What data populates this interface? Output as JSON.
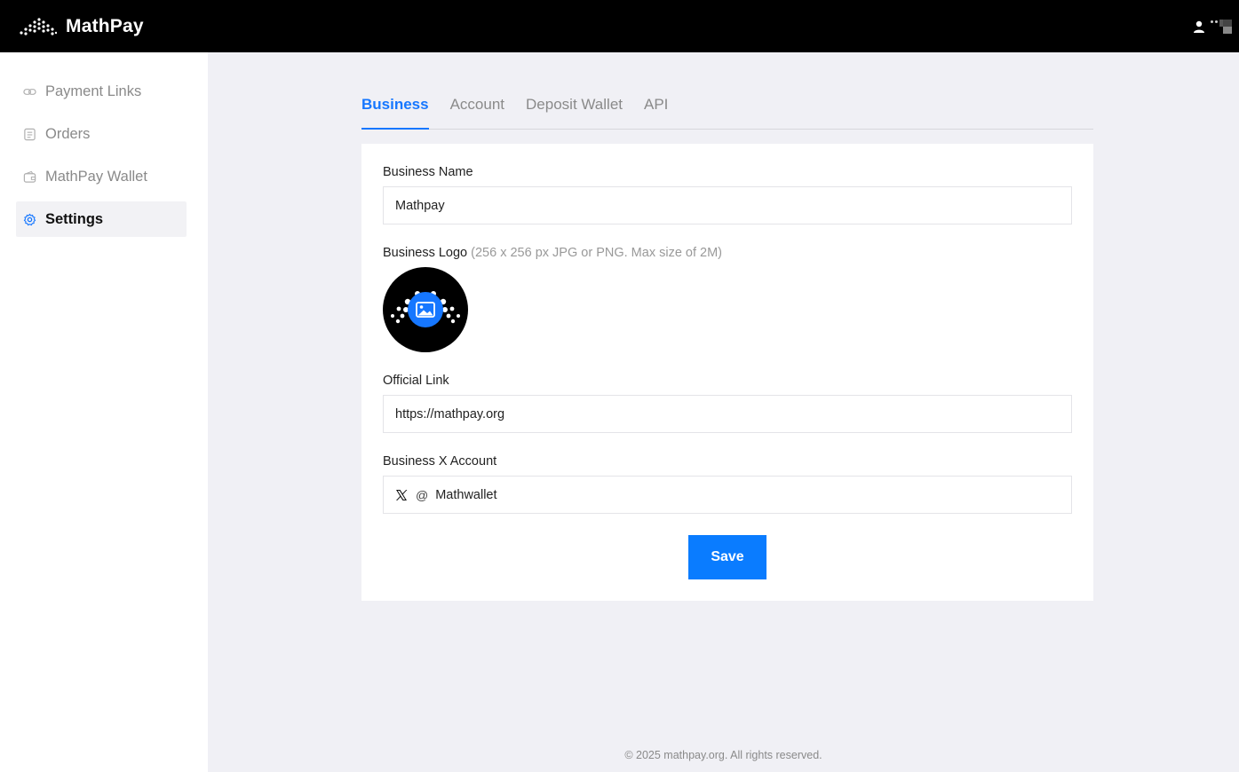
{
  "header": {
    "brand": "MathPay",
    "colors": {
      "background": "#000000",
      "brand_text": "#ffffff"
    },
    "icons": {
      "logo": "mathpay-dots-logo",
      "user": "user-icon",
      "avatar": "avatar-icon"
    }
  },
  "sidebar": {
    "items": [
      {
        "label": "Payment Links",
        "icon": "link-icon",
        "active": false
      },
      {
        "label": "Orders",
        "icon": "document-icon",
        "active": false
      },
      {
        "label": "MathPay Wallet",
        "icon": "wallet-icon",
        "active": false
      },
      {
        "label": "Settings",
        "icon": "gear-icon",
        "active": true
      }
    ]
  },
  "tabs": [
    {
      "label": "Business",
      "active": true
    },
    {
      "label": "Account",
      "active": false
    },
    {
      "label": "Deposit Wallet",
      "active": false
    },
    {
      "label": "API",
      "active": false
    }
  ],
  "form": {
    "business_name": {
      "label": "Business Name",
      "value": "Mathpay"
    },
    "business_logo": {
      "label": "Business Logo",
      "hint": "(256 x 256 px JPG or PNG. Max size of 2M)",
      "icon": "image-upload-icon"
    },
    "official_link": {
      "label": "Official Link",
      "value": "https://mathpay.org"
    },
    "x_account": {
      "label": "Business X Account",
      "prefix": "@",
      "value": "Mathwallet",
      "icon": "x-logo-icon"
    },
    "save_label": "Save"
  },
  "footer": {
    "text": "© 2025 mathpay.org. All rights reserved."
  },
  "colors": {
    "accent": "#1677ff",
    "save_button": "#0a7cff",
    "page_bg": "#f0f0f5"
  }
}
